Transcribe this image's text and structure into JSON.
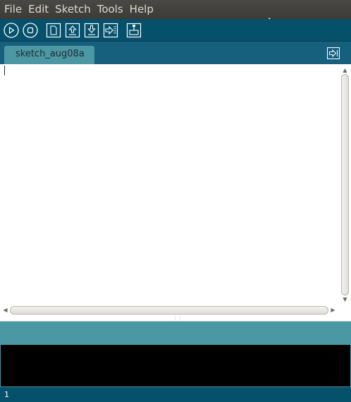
{
  "menubar": {
    "items": [
      "File",
      "Edit",
      "Sketch",
      "Tools",
      "Help"
    ]
  },
  "toolbar": {
    "buttons": [
      "verify-icon",
      "stop-icon",
      "new-icon",
      "open-icon",
      "save-icon",
      "upload-icon",
      "serial-monitor-icon"
    ]
  },
  "tabs": {
    "active": "sketch_aug08a"
  },
  "editor": {
    "content": ""
  },
  "footer": {
    "line_number": "1"
  },
  "colors": {
    "menubar": "#3c3b37",
    "toolbar": "#05506b",
    "tabbar": "#17607d",
    "tab": "#4b97a3",
    "console": "#000000"
  }
}
